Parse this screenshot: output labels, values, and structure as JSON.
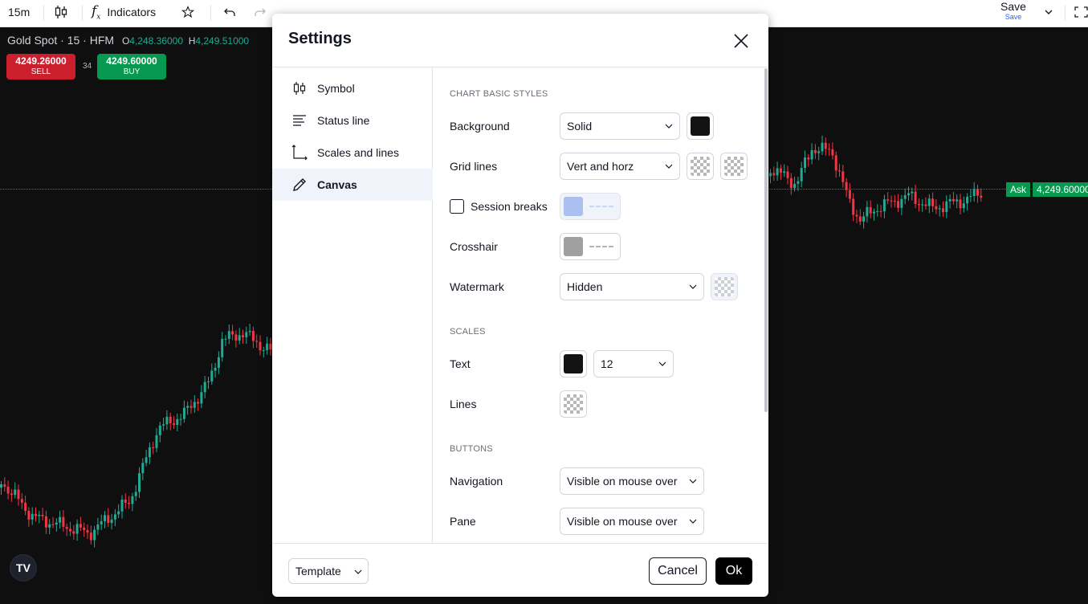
{
  "toolbar": {
    "interval": "15m",
    "indicators": "Indicators",
    "save": "Save",
    "save_sub": "Save"
  },
  "chart": {
    "symbol": "Gold Spot · 15 · HFM",
    "open_label": "O",
    "open_value": "4,248.36000",
    "high_label": "H",
    "high_value": "4,249.51000",
    "sell_price": "4249.26000",
    "sell_label": "SELL",
    "spread": "34",
    "buy_price": "4249.60000",
    "buy_label": "BUY",
    "ask_label": "Ask",
    "ask_price": "4,249.60000",
    "logo": "TV",
    "colors": {
      "up": "#22ab94",
      "down": "#f23645",
      "sell": "#cc1f2d",
      "buy": "#089950",
      "ask": "#089950"
    }
  },
  "dialog": {
    "title": "Settings",
    "tabs": [
      {
        "label": "Symbol",
        "icon": "candles-icon"
      },
      {
        "label": "Status line",
        "icon": "status-line-icon"
      },
      {
        "label": "Scales and lines",
        "icon": "scales-icon"
      },
      {
        "label": "Canvas",
        "icon": "pencil-icon",
        "active": true
      }
    ],
    "sections": {
      "basic": "CHART BASIC STYLES",
      "scales": "SCALES",
      "buttons": "BUTTONS"
    },
    "background": {
      "label": "Background",
      "value": "Solid",
      "color": "#131313"
    },
    "grid_lines": {
      "label": "Grid lines",
      "value": "Vert and horz"
    },
    "session_breaks": {
      "label": "Session breaks",
      "checked": false,
      "color": "#a9c0f0"
    },
    "crosshair": {
      "label": "Crosshair",
      "color": "#a0a0a0"
    },
    "watermark": {
      "label": "Watermark",
      "value": "Hidden"
    },
    "text": {
      "label": "Text",
      "color": "#131313",
      "size": "12"
    },
    "lines": {
      "label": "Lines"
    },
    "navigation": {
      "label": "Navigation",
      "value": "Visible on mouse over"
    },
    "pane": {
      "label": "Pane",
      "value": "Visible on mouse over"
    },
    "footer": {
      "template": "Template",
      "cancel": "Cancel",
      "ok": "Ok"
    }
  }
}
